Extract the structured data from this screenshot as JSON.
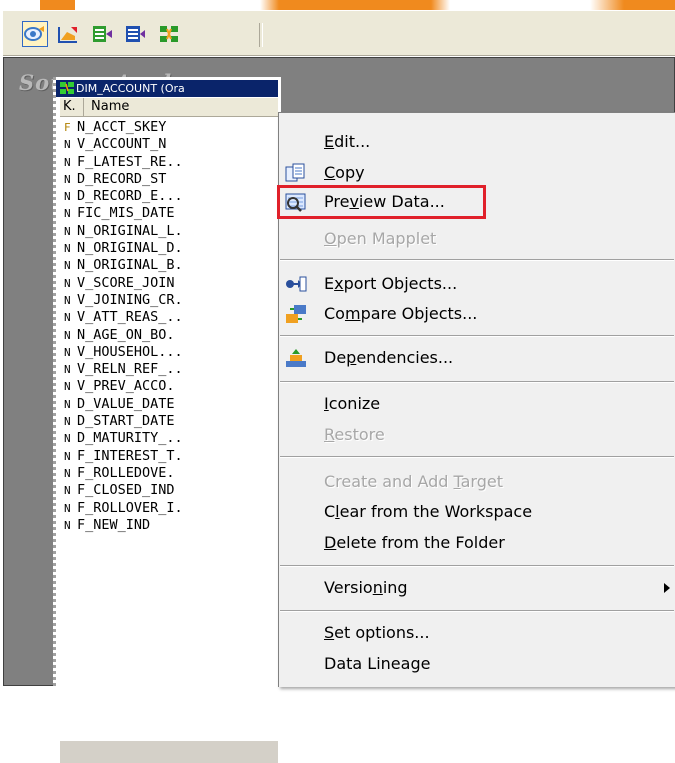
{
  "toolbar": {
    "buttons": [
      {
        "name": "source-analyzer-tool",
        "icon": "source-analyzer-icon",
        "color": "#3a78c8"
      },
      {
        "name": "target-designer-tool",
        "icon": "target-designer-icon",
        "color": "#f0a020"
      },
      {
        "name": "transformation-developer-tool",
        "icon": "transformation-developer-icon",
        "color": "#2f9c2f"
      },
      {
        "name": "mapplet-designer-tool",
        "icon": "mapplet-designer-icon",
        "color": "#2050b0"
      },
      {
        "name": "mapping-designer-tool",
        "icon": "mapping-designer-icon",
        "color": "#2a9a2a"
      }
    ]
  },
  "workspace": {
    "title": "Source Analyzer"
  },
  "source": {
    "header": "DIM_ACCOUNT (Ora",
    "col_key": "K.",
    "col_name": "Name",
    "rows": [
      {
        "k": "F",
        "name": "N_ACCT_SKEY"
      },
      {
        "k": "N",
        "name": "V_ACCOUNT_N"
      },
      {
        "k": "N",
        "name": "F_LATEST_RE.."
      },
      {
        "k": "N",
        "name": "D_RECORD_ST"
      },
      {
        "k": "N",
        "name": "D_RECORD_E..."
      },
      {
        "k": "N",
        "name": "FIC_MIS_DATE"
      },
      {
        "k": "N",
        "name": "N_ORIGINAL_L."
      },
      {
        "k": "N",
        "name": "N_ORIGINAL_D."
      },
      {
        "k": "N",
        "name": "N_ORIGINAL_B."
      },
      {
        "k": "N",
        "name": "V_SCORE_JOIN"
      },
      {
        "k": "N",
        "name": "V_JOINING_CR."
      },
      {
        "k": "N",
        "name": "V_ATT_REAS_.."
      },
      {
        "k": "N",
        "name": "N_AGE_ON_BO."
      },
      {
        "k": "N",
        "name": "V_HOUSEHOL..."
      },
      {
        "k": "N",
        "name": "V_RELN_REF_.."
      },
      {
        "k": "N",
        "name": "V_PREV_ACCO."
      },
      {
        "k": "N",
        "name": "D_VALUE_DATE"
      },
      {
        "k": "N",
        "name": "D_START_DATE"
      },
      {
        "k": "N",
        "name": "D_MATURITY_.."
      },
      {
        "k": "N",
        "name": "F_INTEREST_T."
      },
      {
        "k": "N",
        "name": "F_ROLLEDOVE."
      },
      {
        "k": "N",
        "name": "F_CLOSED_IND"
      },
      {
        "k": "N",
        "name": "F_ROLLOVER_I."
      },
      {
        "k": "N",
        "name": "F_NEW_IND"
      }
    ]
  },
  "menu": {
    "items": [
      {
        "pre": "",
        "u": "E",
        "post": "dit...",
        "icon": "",
        "disabled": false
      },
      {
        "pre": "",
        "u": "C",
        "post": "opy",
        "icon": "copy-icon",
        "disabled": false
      },
      {
        "pre": "Pre",
        "u": "v",
        "post": "iew Data...",
        "icon": "preview-data-icon",
        "disabled": false,
        "highlight": true
      },
      {
        "pre": "",
        "u": "O",
        "post": "pen Mapplet",
        "icon": "",
        "disabled": true
      },
      {
        "pre": "E",
        "u": "x",
        "post": "port Objects...",
        "icon": "export-objects-icon",
        "disabled": false
      },
      {
        "pre": "Co",
        "u": "m",
        "post": "pare Objects...",
        "icon": "compare-objects-icon",
        "disabled": false
      },
      {
        "pre": "De",
        "u": "p",
        "post": "endencies...",
        "icon": "dependencies-icon",
        "disabled": false
      },
      {
        "pre": "",
        "u": "I",
        "post": "conize",
        "icon": "",
        "disabled": false
      },
      {
        "pre": "",
        "u": "R",
        "post": "estore",
        "icon": "",
        "disabled": true
      },
      {
        "pre": "Create and Add ",
        "u": "T",
        "post": "arget",
        "icon": "",
        "disabled": true
      },
      {
        "pre": "C",
        "u": "l",
        "post": "ear from the Workspace",
        "icon": "",
        "disabled": false
      },
      {
        "pre": "",
        "u": "D",
        "post": "elete from the Folder",
        "icon": "",
        "disabled": false
      },
      {
        "pre": "Versio",
        "u": "n",
        "post": "ing",
        "icon": "",
        "disabled": false,
        "submenu": true
      },
      {
        "pre": "",
        "u": "S",
        "post": "et options...",
        "icon": "",
        "disabled": false
      },
      {
        "pre": "Data Lineage",
        "u": "",
        "post": "",
        "icon": "",
        "disabled": false
      }
    ]
  },
  "colors": {
    "accent": "#f08a1e",
    "selection": "#0a246a",
    "highlight_box": "#e0202a"
  }
}
